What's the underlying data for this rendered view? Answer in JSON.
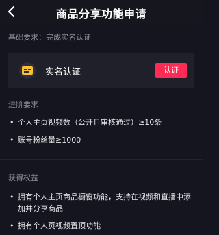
{
  "header": {
    "title": "商品分享功能申请"
  },
  "basic": {
    "label": "基础要求：完成实名认证",
    "card_label": "实名认证",
    "button_label": "认证"
  },
  "advanced": {
    "label": "进阶要求",
    "items": [
      "个人主页视频数（公开且审核通过）≥10条",
      "账号粉丝量≥1000"
    ]
  },
  "benefits": {
    "label": "获得权益",
    "items": [
      "拥有个人主页商品橱窗功能，支持在视频和直播中添加并分享商品",
      "拥有个人页视频置顶功能"
    ]
  },
  "colors": {
    "background": "#15151f",
    "card": "#20202b",
    "accent": "#fe2c55",
    "muted_text": "#8a8a95",
    "icon_yellow": "#f7c234"
  },
  "icons": {
    "back": "back-arrow-icon",
    "id": "id-card-icon"
  }
}
